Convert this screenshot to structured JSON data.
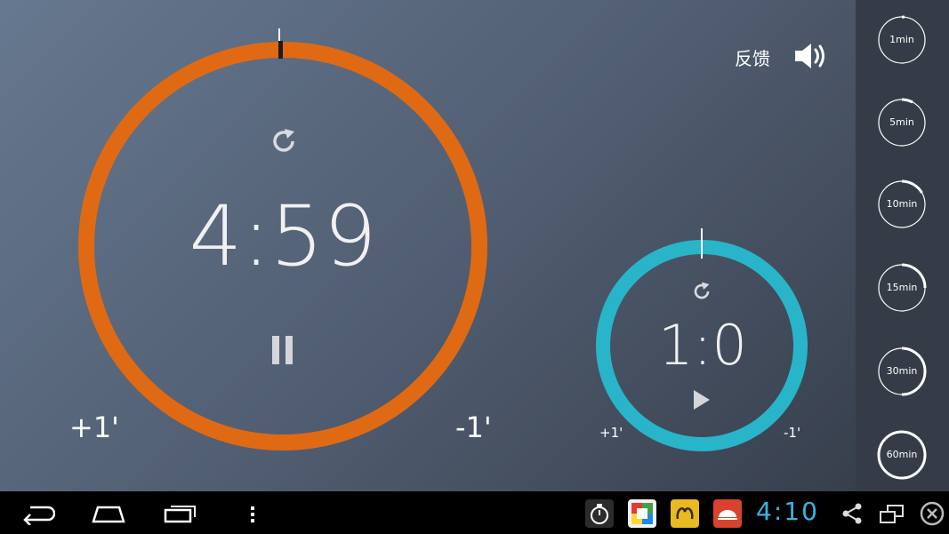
{
  "header": {
    "feedback_label": "反馈"
  },
  "main_timer": {
    "time": "4:59",
    "plus_label": "+1'",
    "minus_label": "-1'",
    "ring_color": "#e06a14",
    "state": "running"
  },
  "second_timer": {
    "time": "1:0",
    "plus_label": "+1'",
    "minus_label": "-1'",
    "ring_color": "#28b5c9",
    "state": "paused"
  },
  "presets": [
    {
      "label": "1min",
      "fraction": 0.03
    },
    {
      "label": "5min",
      "fraction": 0.08
    },
    {
      "label": "10min",
      "fraction": 0.17
    },
    {
      "label": "15min",
      "fraction": 0.25
    },
    {
      "label": "30min",
      "fraction": 0.5
    },
    {
      "label": "60min",
      "fraction": 1.0
    }
  ],
  "status_bar": {
    "clock": "4:10",
    "clock_color": "#35b5e5",
    "icons": [
      "back-icon",
      "home-icon",
      "recent-apps-icon",
      "menu-icon",
      "stopwatch-app-icon",
      "store-app-icon",
      "chat-app-icon",
      "bowl-app-icon",
      "share-icon",
      "window-icon",
      "close-icon"
    ]
  }
}
